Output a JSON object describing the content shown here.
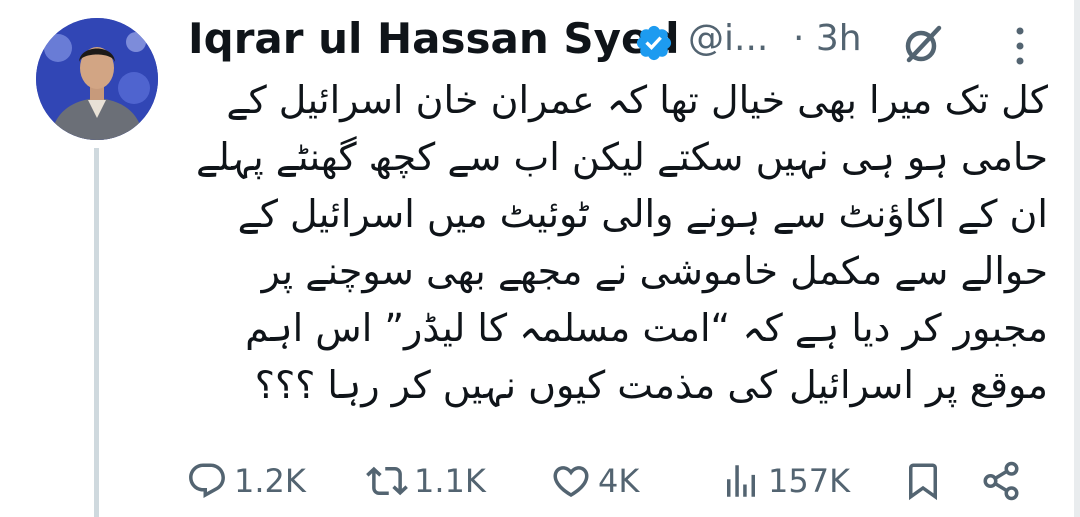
{
  "author": {
    "name": "Iqrar ul Hassan Syed",
    "handle": "@i...",
    "separator": "·",
    "time": "3h"
  },
  "tweet": {
    "text": "کل تک میرا بھی خیال تھا کہ عمران خان اسرائیل کے\nحامی ہو ہی نہیں سکتے لیکن اب سے کچھ گھنٹے پہلے\nان کے اکاؤنٹ سے ہونے والی ٹوئیٹ میں اسرائیل کے\nحوالے سے مکمل خاموشی نے مجھے بھی سوچنے پر\nمجبور کر دیا ہے کہ “امت مسلمہ کا لیڈر” اس اہم\nموقع پر اسرائیل کی مذمت کیوں نہیں کر رہا ؟؟؟"
  },
  "actions": {
    "replies": "1.2K",
    "retweets": "1.1K",
    "likes": "4K",
    "views": "157K"
  },
  "icons": {
    "verified": "verified-badge-icon",
    "grok": "grok-icon",
    "more": "more-options-icon",
    "reply": "reply-icon",
    "retweet": "retweet-icon",
    "like": "heart-icon",
    "views": "views-icon",
    "bookmark": "bookmark-icon",
    "share": "share-icon"
  },
  "colors": {
    "text": "#0f1419",
    "secondary": "#536471",
    "verified": "#1d9bf0",
    "thread_line": "#cfd9de"
  }
}
